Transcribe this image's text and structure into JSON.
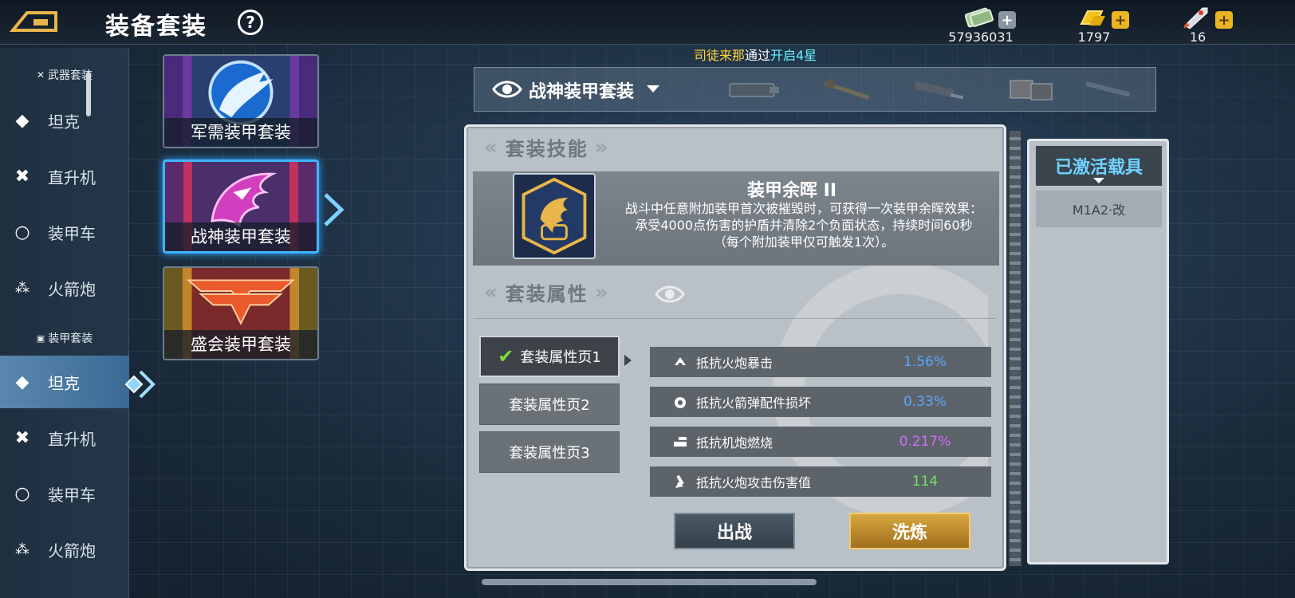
{
  "header": {
    "title": "装备套装",
    "help_icon": "question-icon"
  },
  "currencies": [
    {
      "name": "cash",
      "icon": "cash-icon",
      "value": "57936031"
    },
    {
      "name": "gold",
      "icon": "gold-bars-icon",
      "value": "1797"
    },
    {
      "name": "rocket",
      "icon": "rocket-icon",
      "value": "16"
    }
  ],
  "ticker": {
    "name": "司徒来那",
    "mid": "通过",
    "hi": "开启4星"
  },
  "sidebar": {
    "sections": [
      {
        "title": "武器套装",
        "items": [
          {
            "label": "坦克",
            "icon": "diamond-icon"
          },
          {
            "label": "直升机",
            "icon": "cross-icon"
          },
          {
            "label": "装甲车",
            "icon": "circle-icon"
          },
          {
            "label": "火箭炮",
            "icon": "triple-dot-icon"
          }
        ]
      },
      {
        "title": "装甲套装",
        "items": [
          {
            "label": "坦克",
            "icon": "diamond-icon",
            "active": true
          },
          {
            "label": "直升机",
            "icon": "cross-icon"
          },
          {
            "label": "装甲车",
            "icon": "circle-icon"
          },
          {
            "label": "火箭炮",
            "icon": "triple-dot-icon"
          }
        ]
      }
    ]
  },
  "sets": [
    {
      "name": "军需装甲套装",
      "color": "#2a7ad8"
    },
    {
      "name": "战神装甲套装",
      "color": "#c23fb0",
      "selected": true
    },
    {
      "name": "盛会装甲套装",
      "color": "#e0532a"
    }
  ],
  "weapon_strip": {
    "current_set": "战神装甲套装"
  },
  "skill": {
    "section_title": "套装技能",
    "name": "装甲余晖 II",
    "description": "战斗中任意附加装甲首次被摧毁时，可获得一次装甲余晖效果：承受4000点伤害的护盾并清除2个负面状态，持续时间60秒（每个附加装甲仅可触发1次）。"
  },
  "attributes": {
    "section_title": "套装属性",
    "pages": [
      {
        "label": "套装属性页1",
        "active": true
      },
      {
        "label": "套装属性页2"
      },
      {
        "label": "套装属性页3"
      }
    ],
    "stats": [
      {
        "name": "抵抗火炮暴击",
        "value": "1.56%",
        "color": "#5aa6ff",
        "icon": "cannon-crit-icon"
      },
      {
        "name": "抵抗火箭弹配件损坏",
        "value": "0.33%",
        "color": "#5aa6ff",
        "icon": "rocket-part-icon"
      },
      {
        "name": "抵抗机炮燃烧",
        "value": "0.217%",
        "color": "#d76bff",
        "icon": "autocannon-fire-icon"
      },
      {
        "name": "抵抗火炮攻击伤害值",
        "value": "114",
        "color": "#6fe06a",
        "icon": "cannon-damage-icon"
      }
    ]
  },
  "buttons": {
    "deploy": "出战",
    "refine": "洗炼"
  },
  "activated": {
    "title": "已激活载具",
    "vehicle": "M1A2·改"
  }
}
